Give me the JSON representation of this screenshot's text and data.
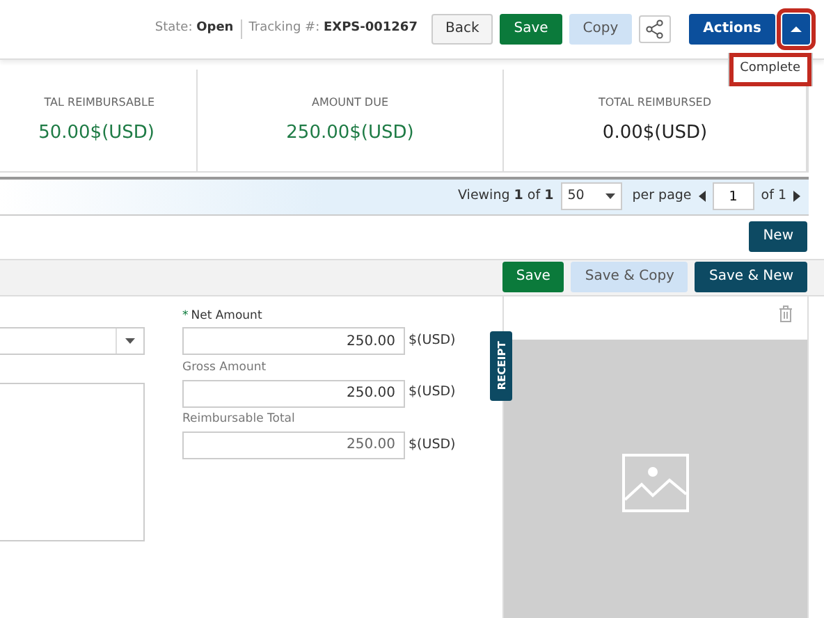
{
  "header": {
    "state_label": "State:",
    "state": "Open",
    "tracking_label": "Tracking #:",
    "tracking": "EXPS-001267",
    "buttons": [
      {
        "kind": "back",
        "label": "Back"
      },
      {
        "kind": "save",
        "label": "Save"
      },
      {
        "kind": "copy",
        "label": "Copy"
      },
      {
        "kind": "share"
      },
      {
        "kind": "actions",
        "label": "Actions"
      },
      {
        "kind": "caret",
        "expanded": true,
        "highlighted": true
      }
    ],
    "menu": [
      {
        "label": "Complete",
        "highlighted": true
      }
    ]
  },
  "summary": [
    {
      "label": "TAL REIMBURSABLE",
      "value": "50.00$(USD)",
      "color": "#1e7b45"
    },
    {
      "label": "AMOUNT DUE",
      "value": "250.00$(USD)",
      "color": "#1e7b45"
    },
    {
      "label": "TOTAL REIMBURSED",
      "value": "0.00$(USD)",
      "color": "#222222"
    }
  ],
  "pager": {
    "viewing_label": "Viewing",
    "current": "1",
    "of_label": "of",
    "total": "1",
    "per_page": "50",
    "per_page_label": "per page",
    "page": "1",
    "page_total": "of 1"
  },
  "list_toolbar": {
    "new_button": "New"
  },
  "form_actions": [
    {
      "kind": "save",
      "label": "Save"
    },
    {
      "kind": "copy",
      "label": "Save & Copy"
    },
    {
      "kind": "new",
      "label": "Save & New"
    }
  ],
  "left_fields": [
    {
      "kind": "select"
    },
    {
      "kind": "textarea"
    }
  ],
  "amount_fields": [
    {
      "label": "Net Amount",
      "required_mark": "*",
      "value": "250.00",
      "currency": "$(USD)",
      "disabled": false
    },
    {
      "label": "Gross Amount",
      "value": "250.00",
      "currency": "$(USD)",
      "disabled": false
    },
    {
      "label": "Reimbursable Total",
      "value": "250.00",
      "currency": "$(USD)",
      "disabled": true
    }
  ],
  "receipt": {
    "tab": "RECEIPT"
  }
}
